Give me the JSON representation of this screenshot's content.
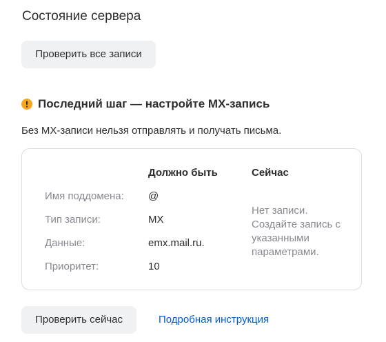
{
  "header": {
    "title": "Состояние сервера",
    "check_all_button": "Проверить все записи"
  },
  "step": {
    "icon": "warning-icon",
    "icon_color": "#f5a623",
    "title": "Последний шаг — настройте MX-запись",
    "description": "Без MX-записи нельзя отправлять и получать письма."
  },
  "record_table": {
    "columns": {
      "expected": "Должно быть",
      "current": "Сейчас"
    },
    "rows": [
      {
        "label": "Имя поддомена:",
        "value": "@"
      },
      {
        "label": "Тип записи:",
        "value": "MX"
      },
      {
        "label": "Данные:",
        "value": "emx.mail.ru."
      },
      {
        "label": "Приоритет:",
        "value": "10"
      }
    ],
    "current_status": "Нет записи. Создайте запись с указанными параметрами."
  },
  "actions": {
    "check_now_button": "Проверить сейчас",
    "instructions_link": "Подробная инструкция"
  },
  "colors": {
    "link": "#005bd1",
    "button_bg": "#f0f1f3",
    "secondary_text": "#87898f"
  }
}
